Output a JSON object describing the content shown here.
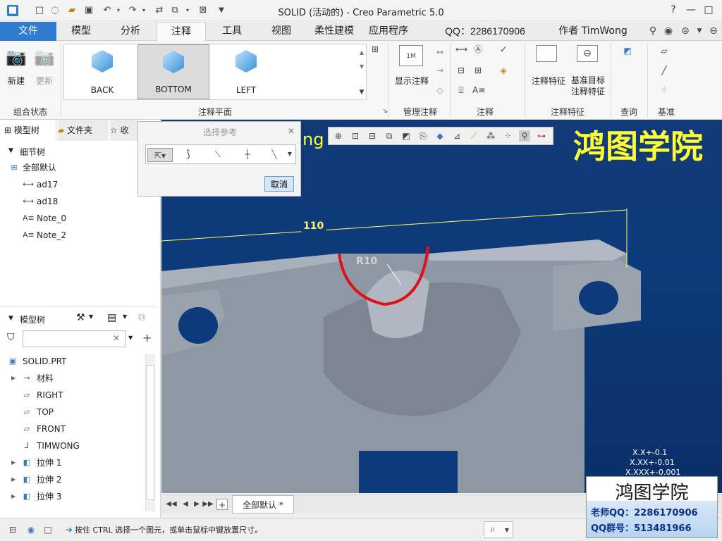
{
  "titlebar": {
    "title": "SOLID (活动的) - Creo Parametric 5.0",
    "window_controls": [
      "?",
      "—",
      "□",
      "✕"
    ]
  },
  "tabs": {
    "file": "文件",
    "items": [
      "模型",
      "分析",
      "注释",
      "工具",
      "视图",
      "柔性建模",
      "应用程序",
      "QQ：2286170906",
      "作者 TimWong"
    ],
    "active": "注释"
  },
  "ribbon": {
    "combo_group": {
      "new_label": "新建",
      "update_label": "更新",
      "group_label": "组合状态"
    },
    "annotation_plane": {
      "items": [
        "BACK",
        "BOTTOM",
        "LEFT"
      ],
      "selected": "BOTTOM",
      "group_label": "注释平面"
    },
    "manage": {
      "show_label": "显示注释",
      "group_label": "管理注释"
    },
    "annotation": {
      "group_label": "注释"
    },
    "features": {
      "feature_label": "注释特征",
      "datum_target_label": "基准目标\n注释特征",
      "group_label": "注释特征"
    },
    "query": {
      "group_label": "查询"
    },
    "datum": {
      "group_label": "基准"
    }
  },
  "left_panel": {
    "tabs": [
      "模型树",
      "文件夹",
      "收"
    ],
    "detail_tree": {
      "header": "细节树",
      "items": [
        {
          "label": "全部默认",
          "icon": "combo-state-icon"
        },
        {
          "label": "ad17",
          "icon": "dimension-icon"
        },
        {
          "label": "ad18",
          "icon": "dimension-icon"
        },
        {
          "label": "Note_0",
          "icon": "note-icon"
        },
        {
          "label": "Note_2",
          "icon": "note-icon"
        }
      ]
    },
    "model_tree": {
      "header": "模型树",
      "filter_placeholder": "",
      "items": [
        {
          "label": "SOLID.PRT",
          "icon": "part-icon",
          "expand": false
        },
        {
          "label": "材料",
          "icon": "material-icon",
          "expand": true
        },
        {
          "label": "RIGHT",
          "icon": "datum-plane-icon",
          "expand": false
        },
        {
          "label": "TOP",
          "icon": "datum-plane-icon",
          "expand": false
        },
        {
          "label": "FRONT",
          "icon": "datum-plane-icon",
          "expand": false
        },
        {
          "label": "TIMWONG",
          "icon": "csys-icon",
          "expand": false
        },
        {
          "label": "拉伸 1",
          "icon": "extrude-icon",
          "expand": true
        },
        {
          "label": "拉伸 2",
          "icon": "extrude-icon",
          "expand": true
        },
        {
          "label": "拉伸 3",
          "icon": "extrude-icon",
          "expand": true
        }
      ]
    }
  },
  "dialog": {
    "title": "选择参考",
    "cancel_label": "取消"
  },
  "viewport": {
    "watermark": "鸿图学院",
    "partial_text": "ng",
    "dimension_110": "110",
    "dimension_r10": "R10",
    "tolerance_lines": [
      "X.X+-0.1",
      "X.XX+-0.01",
      "X.XXX+-0.001"
    ]
  },
  "bottom_tabs": {
    "active_tab": "全部默认 *"
  },
  "status": {
    "message": "按住 CTRL 选择一个图元，或单击鼠标中键放置尺寸。"
  },
  "logo": {
    "title": "鸿图学院",
    "teacher_qq": "老师QQ：2286170906",
    "group_qq": "QQ群号：513481966"
  },
  "colors": {
    "file_tab": "#2e7bcf",
    "viewport_bg": "#0d3a7a",
    "watermark": "#ffff33",
    "dimension": "#ffff66",
    "highlight": "#e0101a"
  }
}
